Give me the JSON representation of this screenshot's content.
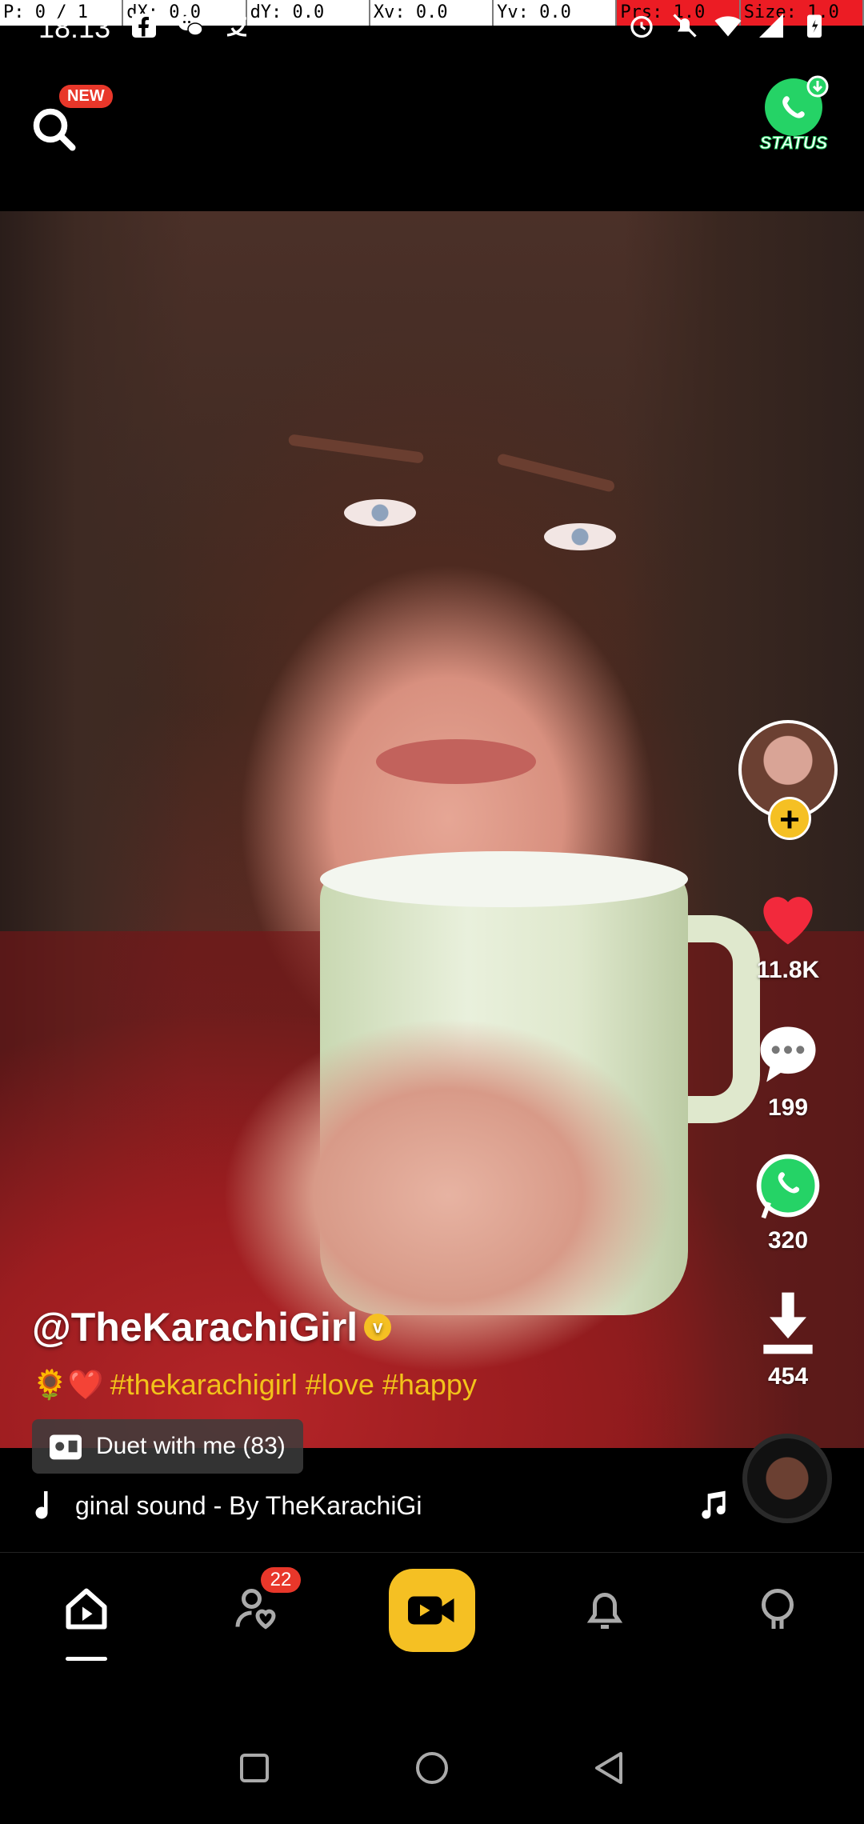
{
  "dev_overlay": {
    "p": "P: 0 / 1",
    "dx": "dX: 0.0",
    "dy": "dY: 0.0",
    "xv": "Xv: 0.0",
    "yv": "Yv: 0.0",
    "prs": "Prs: 1.0",
    "size": "Size: 1.0"
  },
  "status_bar": {
    "time": "18:13",
    "left_icons": [
      "facebook-icon",
      "wechat-icon",
      "alipay-icon"
    ],
    "right_icons": [
      "alarm-icon",
      "mute-icon",
      "wifi-icon",
      "signal-icon",
      "battery-icon"
    ]
  },
  "header": {
    "search_badge": "NEW",
    "status_label": "STATUS"
  },
  "actions": {
    "likes": "11.8K",
    "comments": "199",
    "shares": "320",
    "downloads": "454"
  },
  "post": {
    "username": "@TheKarachiGirl",
    "verified_mark": "v",
    "caption_emoji": "🌻❤️",
    "caption_tags": "#thekarachigirl #love #happy",
    "duet_label": "Duet with me (83)",
    "sound": "ginal sound - By TheKarachiGi"
  },
  "bottom_nav": {
    "items": [
      "home",
      "following",
      "record",
      "notifications",
      "profile"
    ],
    "following_badge": "22",
    "active": "home"
  },
  "colors": {
    "accent": "#f5c023",
    "badge": "#e8372a",
    "heart": "#f2293c",
    "whatsapp": "#25d366"
  }
}
